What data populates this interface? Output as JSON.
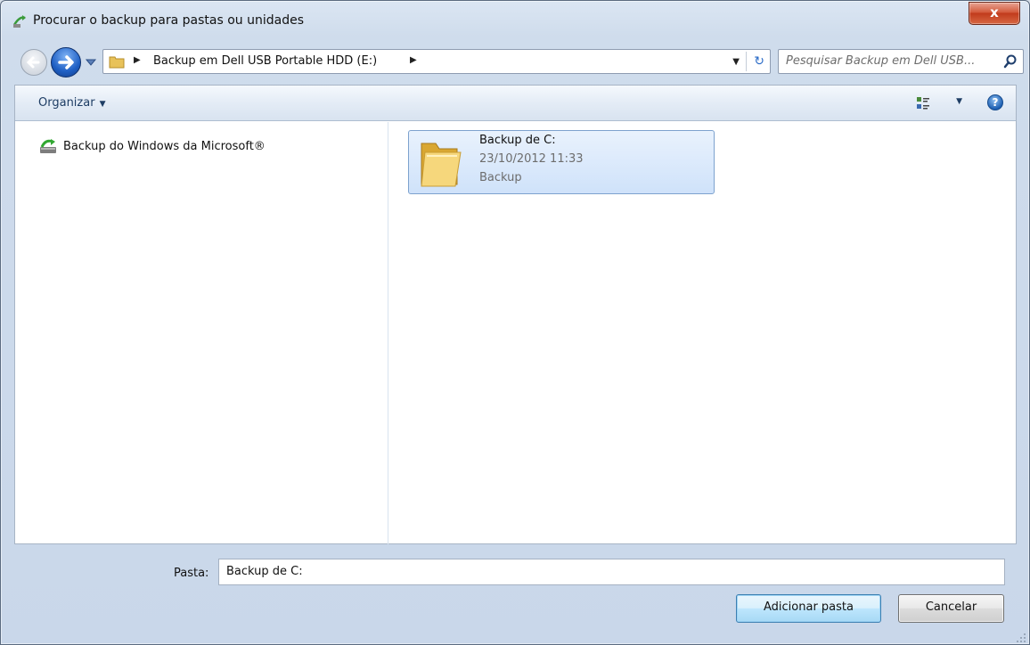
{
  "window": {
    "title": "Procurar o backup para pastas ou unidades",
    "close_label": "x"
  },
  "address": {
    "path": "Backup em Dell USB Portable HDD (E:)",
    "separator": "▶",
    "dropdown_glyph": "▼",
    "refresh_glyph": "↻"
  },
  "search": {
    "placeholder": "Pesquisar Backup em Dell USB..."
  },
  "toolbar": {
    "organize_label": "Organizar",
    "organize_caret": "▼",
    "view_caret": "▼",
    "help_label": "?"
  },
  "navpane": {
    "items": [
      {
        "label": "Backup do Windows da Microsoft®",
        "icon": "backup-icon"
      }
    ]
  },
  "files": [
    {
      "name": "Backup de C:",
      "date": "23/10/2012 11:33",
      "type": "Backup",
      "icon": "folder-icon",
      "selected": true
    }
  ],
  "bottom": {
    "folder_label": "Pasta:",
    "folder_value": "Backup de C:",
    "add_button_label": "Adicionar pasta",
    "cancel_button_label": "Cancelar"
  },
  "colors": {
    "selection_bg": "#cfe2fa",
    "selection_border": "#7da2ce",
    "close_red": "#c13b1c",
    "accent_blue": "#1e5fc4"
  }
}
